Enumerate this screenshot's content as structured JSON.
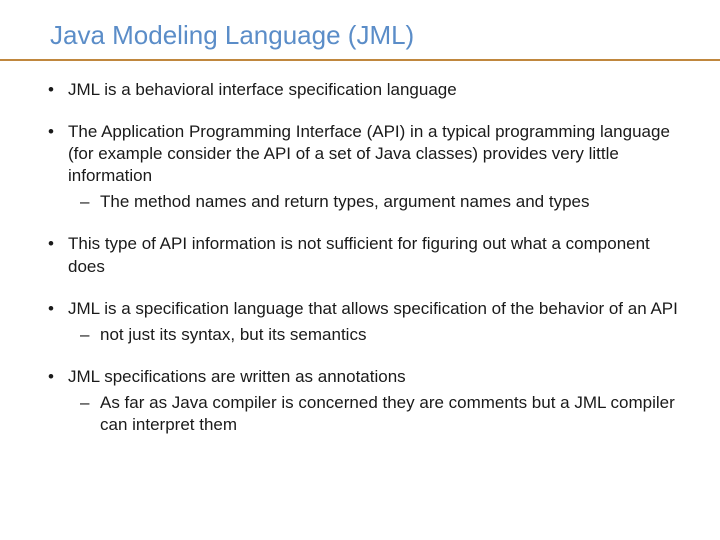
{
  "title": "Java Modeling Language (JML)",
  "bullets": {
    "b0": "JML is a behavioral interface specification language",
    "b1": "The Application Programming Interface (API) in a typical programming language (for example consider the API of a set of Java classes) provides very little information",
    "b1_s0": "The method names and return types, argument names and types",
    "b2": "This type of API information is not sufficient for figuring out what a component does",
    "b3": "JML is a specification language that allows specification of the behavior of an API",
    "b3_s0": "not just its syntax, but its semantics",
    "b4": "JML specifications are written as annotations",
    "b4_s0": "As far as Java compiler is concerned they are comments but a JML compiler can interpret them"
  }
}
